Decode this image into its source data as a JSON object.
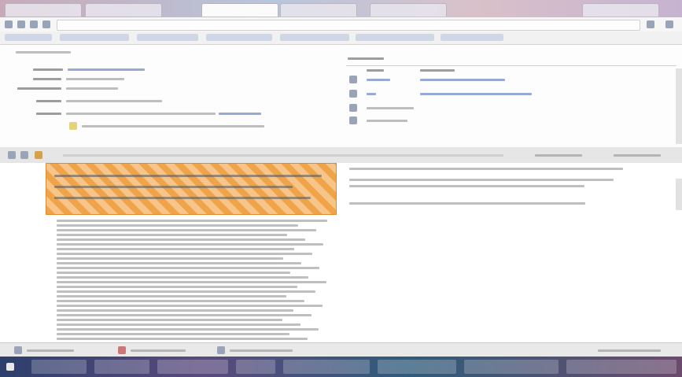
{
  "window": {
    "title": ""
  },
  "tabs": [
    {
      "label": ""
    },
    {
      "label": ""
    },
    {
      "label": "",
      "active": true
    },
    {
      "label": ""
    },
    {
      "label": ""
    },
    {
      "label": ""
    }
  ],
  "address_bar": {
    "url": ""
  },
  "bookmarks": [
    {
      "label": ""
    },
    {
      "label": ""
    },
    {
      "label": ""
    },
    {
      "label": ""
    },
    {
      "label": ""
    },
    {
      "label": ""
    },
    {
      "label": ""
    }
  ],
  "top_pane": {
    "heading": "",
    "fields": [
      {
        "label": "",
        "value": ""
      },
      {
        "label": "",
        "value": ""
      },
      {
        "label": "",
        "value": ""
      },
      {
        "label": "",
        "value": ""
      },
      {
        "label": "",
        "value": ""
      }
    ],
    "right_panel": {
      "heading": "",
      "columns": [
        "",
        ""
      ],
      "rows": [
        {
          "name": "",
          "desc": ""
        },
        {
          "name": "",
          "desc": ""
        },
        {
          "name": "",
          "desc": ""
        },
        {
          "name": "",
          "desc": ""
        }
      ]
    }
  },
  "bottom_pane": {
    "highlight_text": "",
    "body_text": "",
    "right_text": ""
  },
  "status_bar": {
    "items": [
      "",
      "",
      ""
    ]
  },
  "taskbar": {
    "items": [
      "",
      "",
      "",
      "",
      "",
      "",
      "",
      ""
    ]
  },
  "colors": {
    "highlight": "#f0a44a",
    "taskbar": "#2d3f6c"
  },
  "icons": [
    "back-icon",
    "forward-icon",
    "reload-icon",
    "home-icon",
    "star-icon",
    "menu-icon",
    "start-icon"
  ]
}
